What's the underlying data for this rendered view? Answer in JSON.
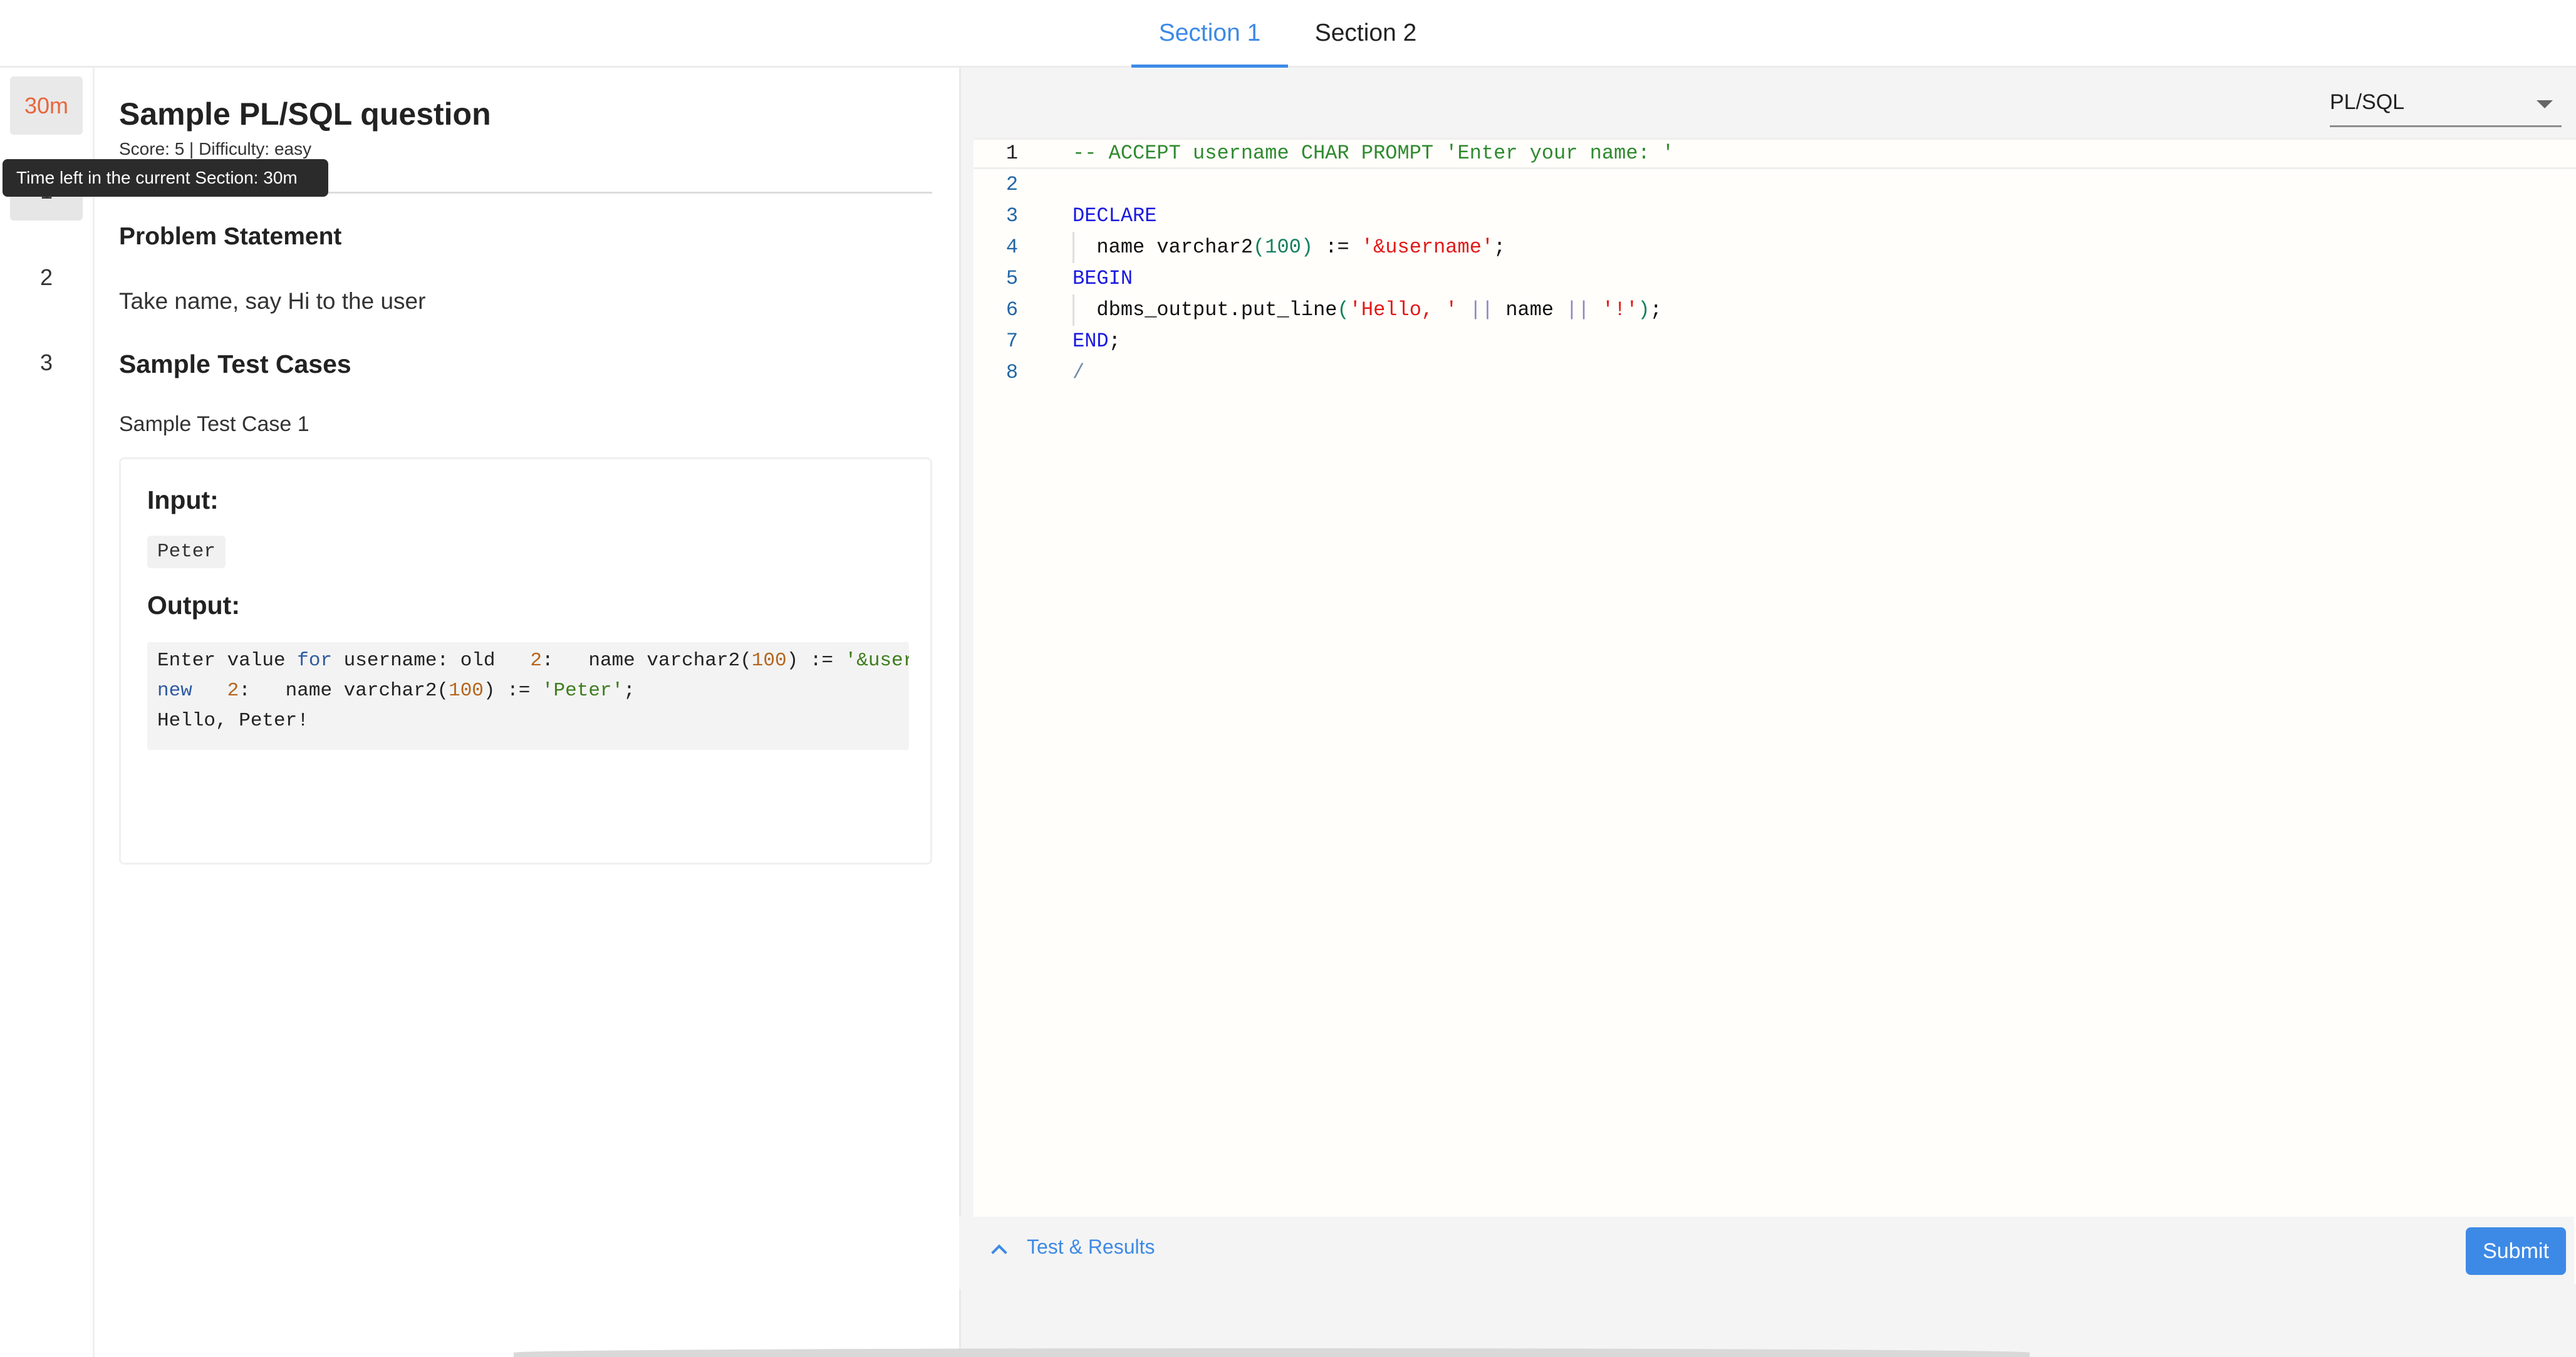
{
  "tabs": [
    {
      "label": "Section 1",
      "active": true
    },
    {
      "label": "Section 2",
      "active": false
    }
  ],
  "rail": {
    "timer": "30m",
    "questions": [
      "1",
      "2",
      "3"
    ],
    "active_question": "1"
  },
  "tooltip": "Time left in the current Section: 30m",
  "question": {
    "title": "Sample PL/SQL question",
    "meta": "Score: 5 | Difficulty: easy",
    "problem_heading": "Problem Statement",
    "problem_text": "Take name, say Hi to the user",
    "samples_heading": "Sample Test Cases",
    "sample_label": "Sample Test Case 1",
    "input_heading": "Input:",
    "input_value": "Peter",
    "output_heading": "Output:",
    "output_lines": [
      "Enter value for username: old   2:   name varchar2(100) := '&user",
      "new   2:   name varchar2(100) := 'Peter';",
      "Hello, Peter!"
    ]
  },
  "editor": {
    "language": "PL/SQL",
    "line_numbers": [
      "1",
      "2",
      "3",
      "4",
      "5",
      "6",
      "7",
      "8"
    ],
    "lines": [
      "-- ACCEPT username CHAR PROMPT 'Enter your name: '",
      "",
      "DECLARE",
      "  name varchar2(100) := '&username';",
      "BEGIN",
      "  dbms_output.put_line('Hello, ' || name || '!');",
      "END;",
      "/"
    ]
  },
  "bottom": {
    "results_label": "Test & Results",
    "submit_label": "Submit"
  },
  "colors": {
    "accent": "#3d8ae6",
    "timer": "#e8663d",
    "comment": "#2f8a2f",
    "keyword": "#1a1ae0",
    "string": "#e11a1a",
    "number": "#13805f"
  },
  "icons": [
    "chevron-up-icon",
    "dropdown-caret-icon"
  ]
}
